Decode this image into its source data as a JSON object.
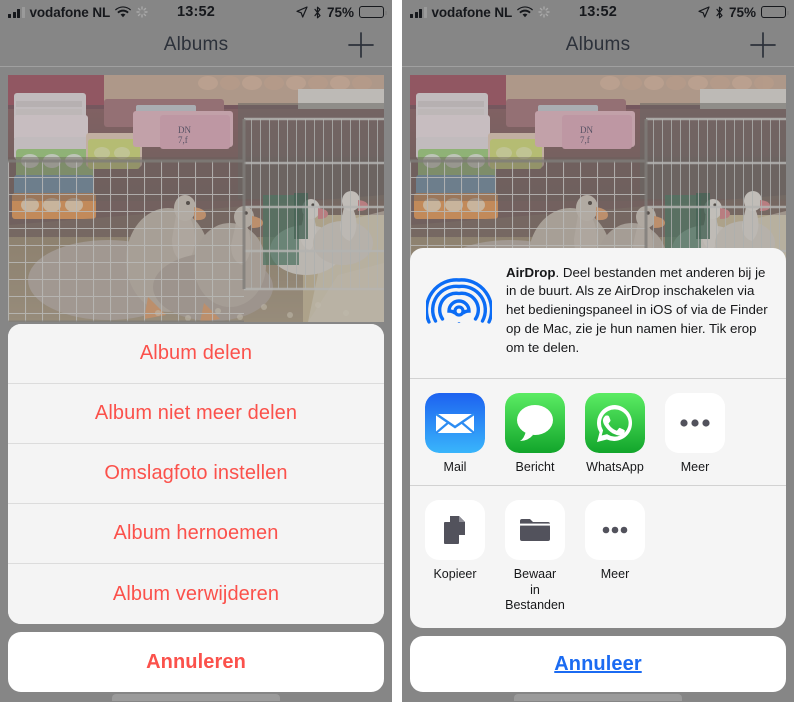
{
  "status_bar": {
    "carrier": "vodafone NL",
    "time": "13:52",
    "battery_percent": "75%",
    "wifi_icon": "wifi-icon",
    "sync_icon": "sync-spinner-icon",
    "location_icon": "location-arrow-icon",
    "bluetooth_icon": "bluetooth-icon",
    "signal_icon": "signal-bars-icon",
    "battery_icon": "battery-icon"
  },
  "nav_bar": {
    "title": "Albums",
    "add_icon": "plus-icon"
  },
  "photo": {
    "alt": "geese-in-wire-cages-market-photo"
  },
  "left_panel": {
    "action_sheet": {
      "items": [
        {
          "label": "Album delen"
        },
        {
          "label": "Album niet meer delen"
        },
        {
          "label": "Omslagfoto instellen"
        },
        {
          "label": "Album hernoemen"
        },
        {
          "label": "Album verwijderen"
        }
      ],
      "cancel_label": "Annuleren"
    }
  },
  "right_panel": {
    "share_sheet": {
      "airdrop": {
        "title": "AirDrop",
        "description": ". Deel bestanden met anderen bij je in de buurt. Als ze AirDrop inschakelen via het bedieningspaneel in iOS of via de Finder op de Mac, zie je hun namen hier. Tik erop om te delen.",
        "icon": "airdrop-icon"
      },
      "apps": [
        {
          "label": "Mail",
          "icon": "mail-icon"
        },
        {
          "label": "Bericht",
          "icon": "messages-icon"
        },
        {
          "label": "WhatsApp",
          "icon": "whatsapp-icon"
        },
        {
          "label": "Meer",
          "icon": "more-dots-icon"
        }
      ],
      "actions": [
        {
          "label": "Kopieer",
          "icon": "copy-icon"
        },
        {
          "label": "Bewaar\nin Bestanden",
          "icon": "folder-icon"
        },
        {
          "label": "Meer",
          "icon": "more-dots-icon"
        }
      ],
      "cancel_label": "Annuleer"
    }
  },
  "colors": {
    "destructive_red": "#fb514b",
    "link_blue": "#1b6bf2",
    "airdrop_blue": "#0b6cf5",
    "dim_overlay": "#868686"
  }
}
